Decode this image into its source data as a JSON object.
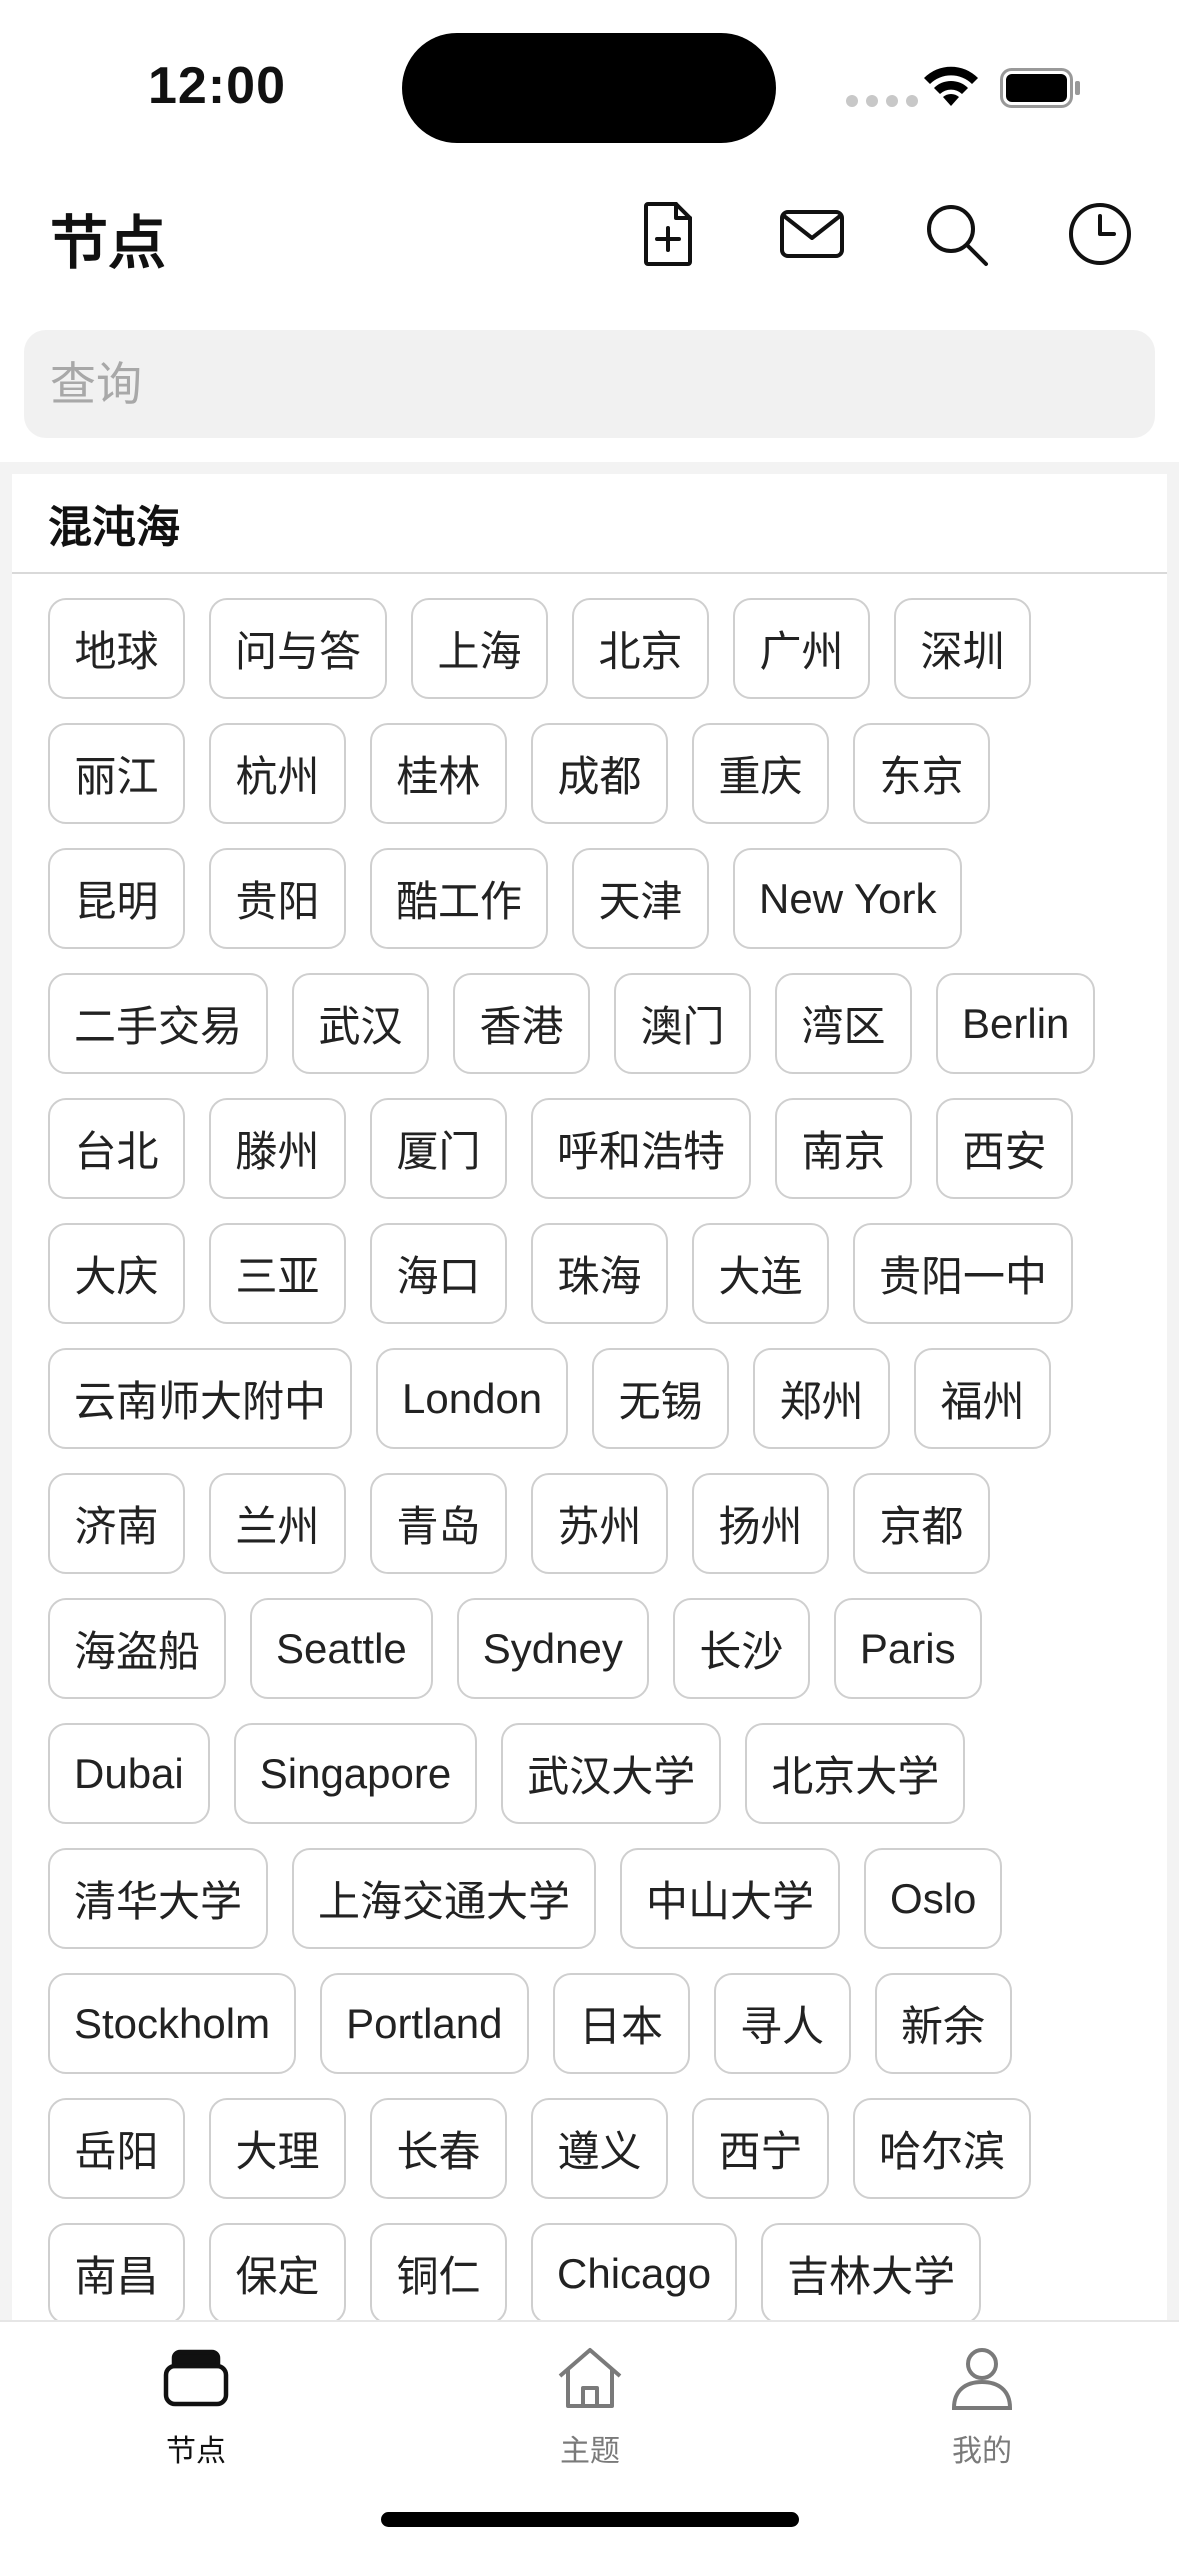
{
  "status_bar": {
    "time": "12:00"
  },
  "header": {
    "title": "节点",
    "icons": [
      "new-document-icon",
      "mail-icon",
      "search-icon",
      "history-clock-icon"
    ]
  },
  "search": {
    "placeholder": "查询",
    "value": ""
  },
  "section": {
    "title": "混沌海",
    "tags": [
      "地球",
      "问与答",
      "上海",
      "北京",
      "广州",
      "深圳",
      "丽江",
      "杭州",
      "桂林",
      "成都",
      "重庆",
      "东京",
      "昆明",
      "贵阳",
      "酷工作",
      "天津",
      "New York",
      "二手交易",
      "武汉",
      "香港",
      "澳门",
      "湾区",
      "Berlin",
      "台北",
      "滕州",
      "厦门",
      "呼和浩特",
      "南京",
      "西安",
      "大庆",
      "三亚",
      "海口",
      "珠海",
      "大连",
      "贵阳一中",
      "云南师大附中",
      "London",
      "无锡",
      "郑州",
      "福州",
      "济南",
      "兰州",
      "青岛",
      "苏州",
      "扬州",
      "京都",
      "海盗船",
      "Seattle",
      "Sydney",
      "长沙",
      "Paris",
      "Dubai",
      "Singapore",
      "武汉大学",
      "北京大学",
      "清华大学",
      "上海交通大学",
      "中山大学",
      "Oslo",
      "Stockholm",
      "Portland",
      "日本",
      "寻人",
      "新余",
      "岳阳",
      "大理",
      "长春",
      "遵义",
      "西宁",
      "哈尔滨",
      "南昌",
      "保定",
      "铜仁",
      "Chicago",
      "吉林大学"
    ]
  },
  "tabbar": {
    "items": [
      {
        "label": "节点",
        "icon": "nodes-icon",
        "active": true
      },
      {
        "label": "主题",
        "icon": "home-icon",
        "active": false
      },
      {
        "label": "我的",
        "icon": "person-icon",
        "active": false
      }
    ]
  }
}
